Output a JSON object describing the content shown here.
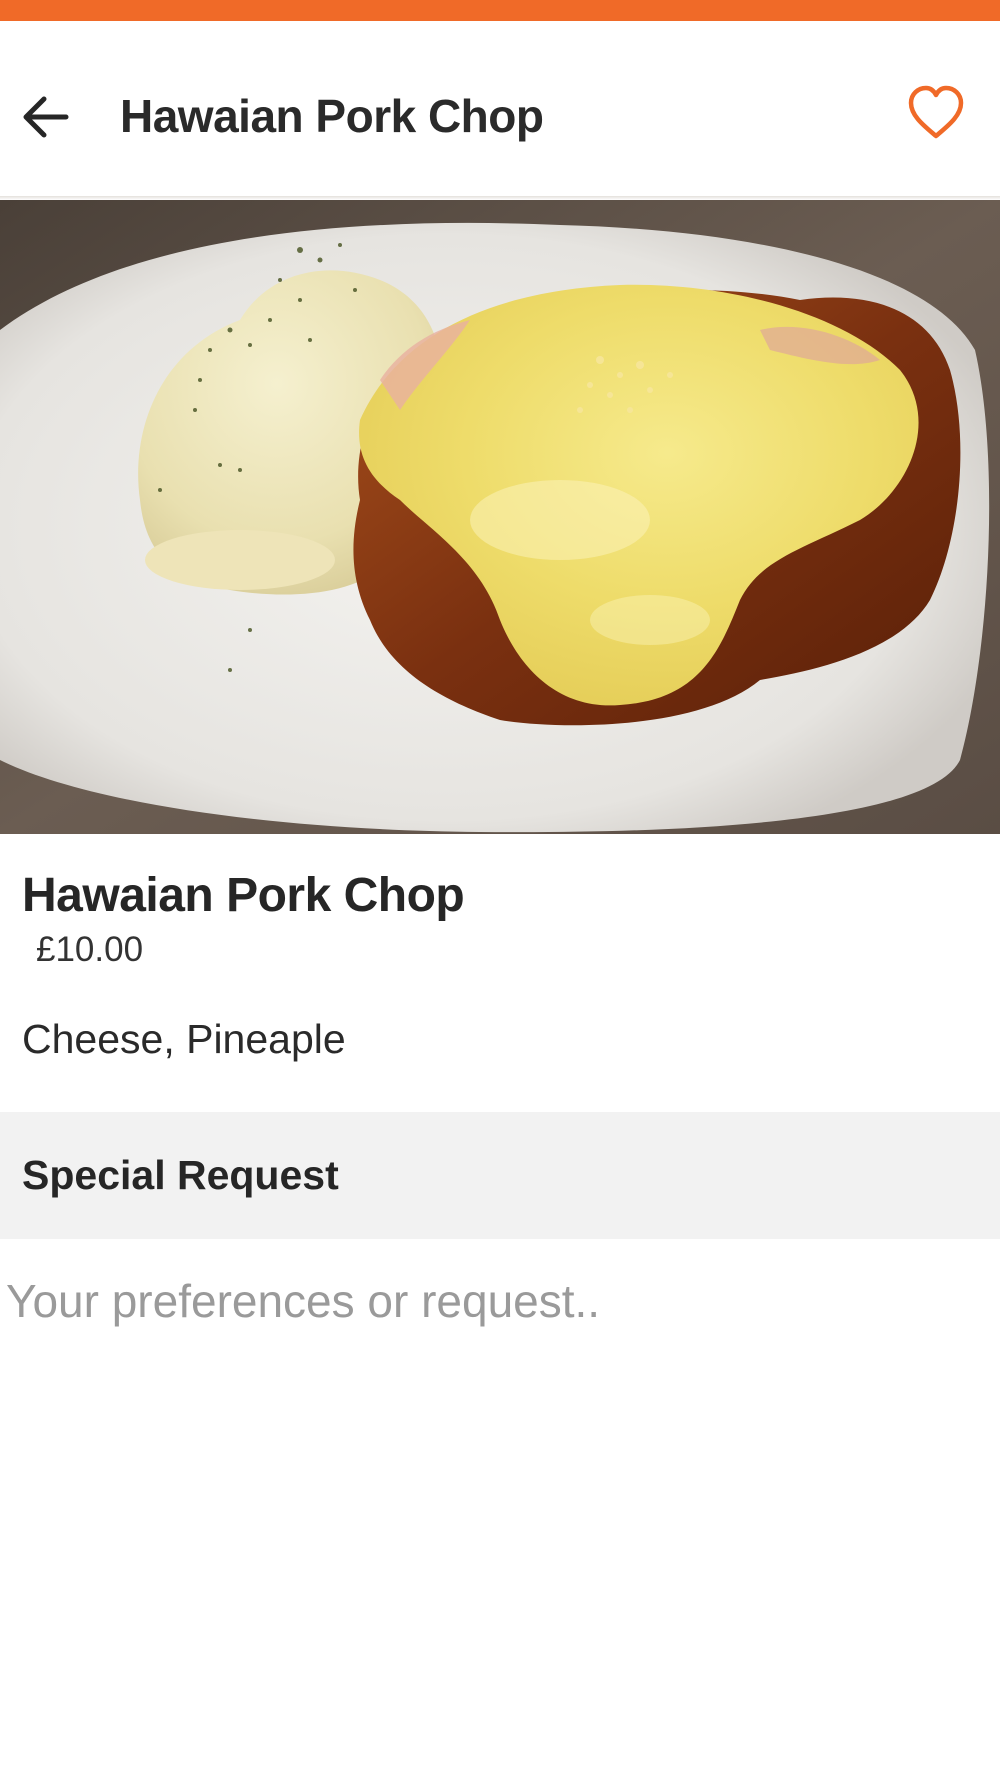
{
  "colors": {
    "accent": "#f06a28",
    "text_primary": "#262626",
    "placeholder": "#9a9a9a",
    "section_background": "#f2f2f2"
  },
  "app_bar": {
    "title": "Hawaian Pork Chop",
    "back_icon": "arrow-left-icon",
    "favorite_icon": "heart-outline-icon"
  },
  "item": {
    "photo": "pork chop with melted cheese and mashed potatoes on a white plate",
    "name": "Hawaian Pork Chop",
    "price": "£10.00",
    "description": "Cheese, Pineaple"
  },
  "special_request": {
    "title": "Special Request",
    "placeholder": "Your preferences or request..",
    "value": ""
  }
}
